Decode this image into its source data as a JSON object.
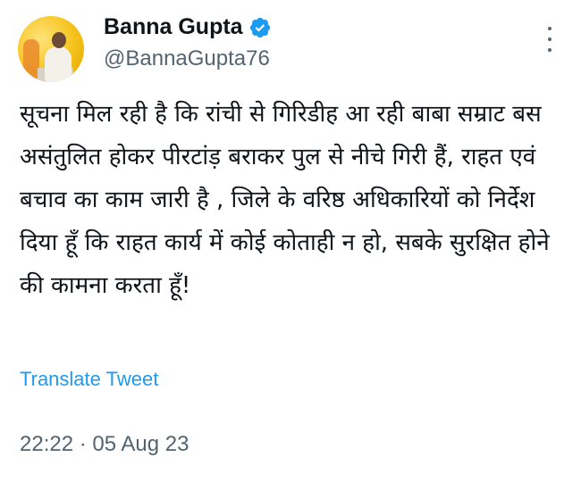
{
  "author": {
    "name": "Banna Gupta",
    "handle": "@BannaGupta76",
    "verified": true,
    "verified_color": "#1d9bf0"
  },
  "tweet": {
    "text": "सूचना मिल रही है कि रांची से गिरिडीह आ रही बाबा सम्राट बस असंतुलित होकर पीरटांड़ बराकर पुल से नीचे गिरी हैं, राहत एवं बचाव का काम जारी है , जिले के वरिष्ठ अधिकारियों को निर्देश दिया हूँ कि राहत कार्य में कोई कोताही न हो, सबके सुरक्षित होने की कामना करता हूँ!",
    "translate_label": "Translate Tweet",
    "timestamp": "22:22 · 05 Aug 23"
  },
  "icons": {
    "more": "more-options-icon",
    "verified": "verified-badge-icon"
  },
  "colors": {
    "link": "#1d9bf0",
    "secondary_text": "#536471",
    "primary_text": "#0f1419"
  }
}
